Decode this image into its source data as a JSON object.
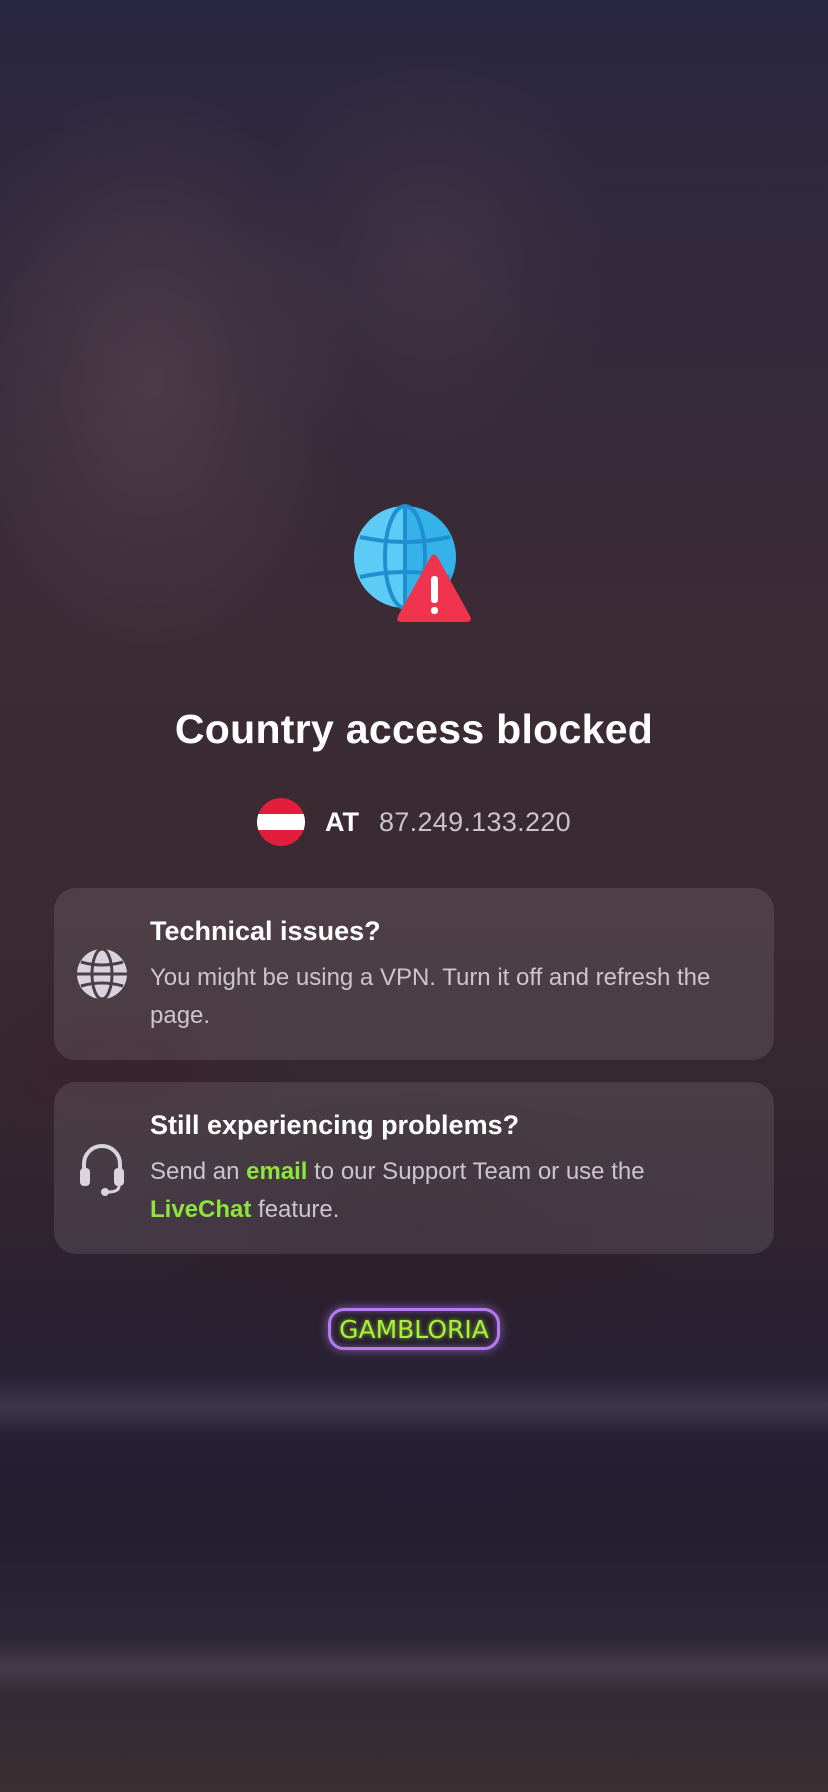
{
  "page": {
    "title": "Country access blocked"
  },
  "location": {
    "flag_icon": "austria-flag-icon",
    "country_code": "AT",
    "ip_address": "87.249.133.220"
  },
  "cards": [
    {
      "icon": "globe-icon",
      "title": "Technical issues?",
      "body": "You might be using a VPN. Turn it off and refresh the page."
    },
    {
      "icon": "headset-icon",
      "title": "Still experiencing problems?",
      "body_prefix": "Send an",
      "email_link": "email",
      "body_middle": "to our Support Team or use the",
      "livechat_link": "LiveChat",
      "body_suffix": "feature."
    }
  ],
  "logo": {
    "text": "GAMBLORIA"
  },
  "colors": {
    "accent_link": "#8de53a",
    "logo_border": "#b57cf2",
    "logo_text": "#a8f23a",
    "warning_red": "#f0344d",
    "globe_blue": "#3ab4ea"
  }
}
